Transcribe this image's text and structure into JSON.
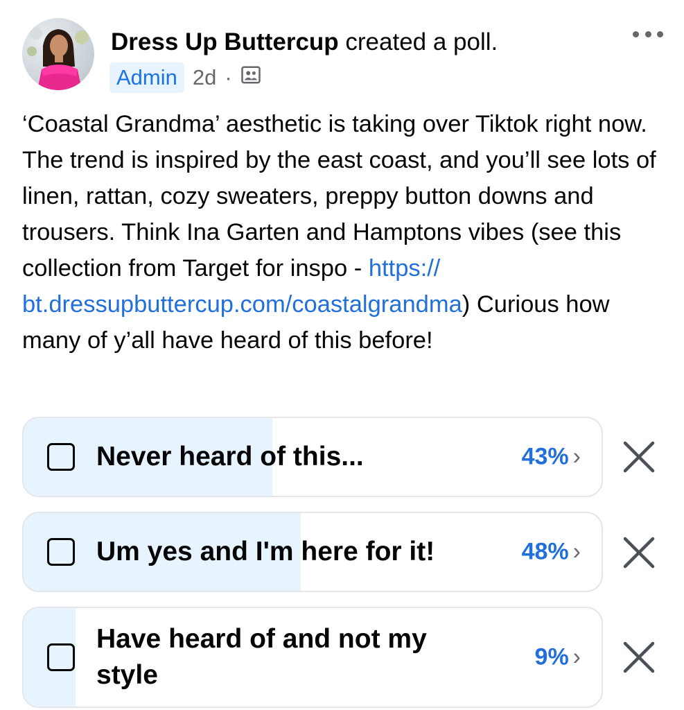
{
  "post": {
    "author": "Dress Up Buttercup",
    "action": " created a poll.",
    "badge": "Admin",
    "time": "2d",
    "dot": "·",
    "audience_icon": "group-icon",
    "more_icon": "more-options-icon",
    "text_before_link": "‘Coastal Grandma’ aesthetic is taking over Tiktok right now. The trend is inspired by the east coast, and you’ll see lots of linen, rattan, cozy sweaters, preppy button downs and trousers. Think Ina Garten and Hamptons vibes (see this collection from Target for inspo - ",
    "link_text": "https:// bt.dressupbuttercup.com/coastalgrandma",
    "text_after_link": ") Curious how many of y’all have heard of this before!"
  },
  "poll": {
    "options": [
      {
        "label": "Never heard of this...",
        "percent_label": "43%",
        "fill_fraction": 0.43
      },
      {
        "label": "Um yes and I'm here for it!",
        "percent_label": "48%",
        "fill_fraction": 0.48
      },
      {
        "label": "Have heard of and not my style",
        "percent_label": "9%",
        "fill_fraction": 0.09
      }
    ],
    "chevron": "›",
    "remove_icon": "close-icon"
  },
  "colors": {
    "link": "#216fdb",
    "fill": "#e7f3ff",
    "muted": "#65676b"
  }
}
